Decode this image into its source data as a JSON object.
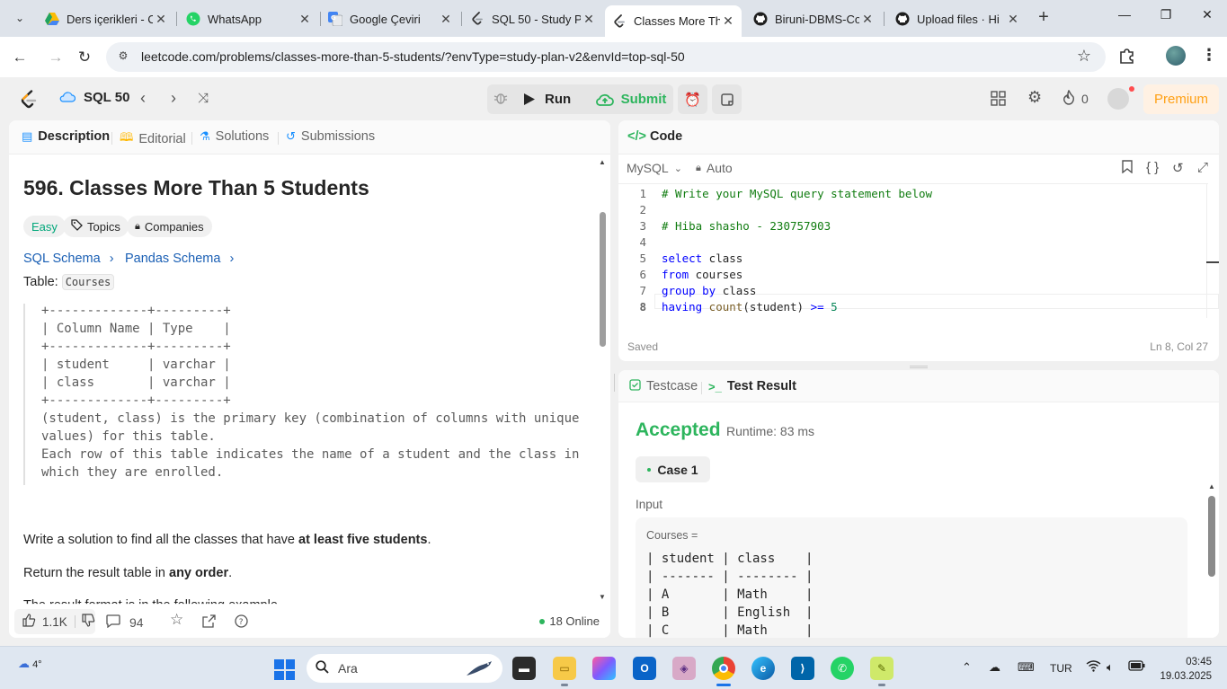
{
  "browser": {
    "tabs": [
      {
        "title": "Ders içerikleri - C",
        "icon": "google-drive-icon"
      },
      {
        "title": "WhatsApp",
        "icon": "whatsapp-icon"
      },
      {
        "title": "Google Çeviri",
        "icon": "google-translate-icon"
      },
      {
        "title": "SQL 50 - Study P",
        "icon": "leetcode-icon"
      },
      {
        "title": "Classes More Th",
        "icon": "leetcode-icon",
        "active": true
      },
      {
        "title": "Biruni-DBMS-Co",
        "icon": "github-icon"
      },
      {
        "title": "Upload files · Hi",
        "icon": "github-icon"
      }
    ],
    "url": "leetcode.com/problems/classes-more-than-5-students/?envType=study-plan-v2&envId=top-sql-50"
  },
  "lc_header": {
    "study_plan": "SQL 50",
    "run_label": "Run",
    "submit_label": "Submit",
    "streak_count": "0",
    "premium_label": "Premium"
  },
  "left": {
    "tabs": {
      "description": "Description",
      "editorial": "Editorial",
      "solutions": "Solutions",
      "submissions": "Submissions"
    },
    "title": "596. Classes More Than 5 Students",
    "difficulty": "Easy",
    "topics": "Topics",
    "companies": "Companies",
    "sql_schema": "SQL Schema",
    "pandas_schema": "Pandas Schema",
    "table_label": "Table:",
    "table_name": "Courses",
    "schema_lines": [
      "+-------------+---------+",
      "| Column Name | Type    |",
      "+-------------+---------+",
      "| student     | varchar |",
      "| class       | varchar |",
      "+-------------+---------+",
      "(student, class) is the primary key (combination of columns with unique",
      "values) for this table.",
      "Each row of this table indicates the name of a student and the class in",
      "which they are enrolled."
    ],
    "para1_pre": "Write a solution to find all the classes that have ",
    "para1_bold": "at least five students",
    "para1_post": ".",
    "para2_pre": "Return the result table in ",
    "para2_bold": "any order",
    "para2_post": ".",
    "para3_partial": "The result format is in the following example.",
    "likes": "1.1K",
    "comments": "94",
    "online": "18 Online"
  },
  "code": {
    "header": "Code",
    "language": "MySQL",
    "mode": "Auto",
    "lines": [
      {
        "n": "1",
        "parts": [
          {
            "t": "# Write your MySQL query statement below",
            "c": "comment"
          }
        ]
      },
      {
        "n": "2",
        "parts": []
      },
      {
        "n": "3",
        "parts": [
          {
            "t": "# Hiba shasho - 230757903",
            "c": "comment"
          }
        ]
      },
      {
        "n": "4",
        "parts": []
      },
      {
        "n": "5",
        "parts": [
          {
            "t": "select",
            "c": "kw"
          },
          {
            "t": " class",
            "c": "txt"
          }
        ]
      },
      {
        "n": "6",
        "parts": [
          {
            "t": "from",
            "c": "kw"
          },
          {
            "t": " courses",
            "c": "txt"
          }
        ]
      },
      {
        "n": "7",
        "parts": [
          {
            "t": "group by",
            "c": "kw"
          },
          {
            "t": " class",
            "c": "txt"
          }
        ]
      },
      {
        "n": "8",
        "parts": [
          {
            "t": "having",
            "c": "kw"
          },
          {
            "t": " count",
            "c": "fn"
          },
          {
            "t": "(student) ",
            "c": "txt"
          },
          {
            "t": ">=",
            "c": "kw"
          },
          {
            "t": " 5",
            "c": "num"
          }
        ]
      }
    ],
    "status": "Saved",
    "cursor": "Ln 8, Col 27"
  },
  "result": {
    "testcase_tab": "Testcase",
    "result_tab": "Test Result",
    "verdict": "Accepted",
    "runtime": "Runtime: 83 ms",
    "case": "Case 1",
    "input_label": "Input",
    "var_label": "Courses =",
    "table_lines": [
      "| student | class    |",
      "| ------- | -------- |",
      "| A       | Math     |",
      "| B       | English  |",
      "| C       | Math     |"
    ]
  },
  "taskbar": {
    "temperature": "4°",
    "search": "Ara",
    "language": "TUR",
    "time": "03:45",
    "date": "19.03.2025"
  }
}
